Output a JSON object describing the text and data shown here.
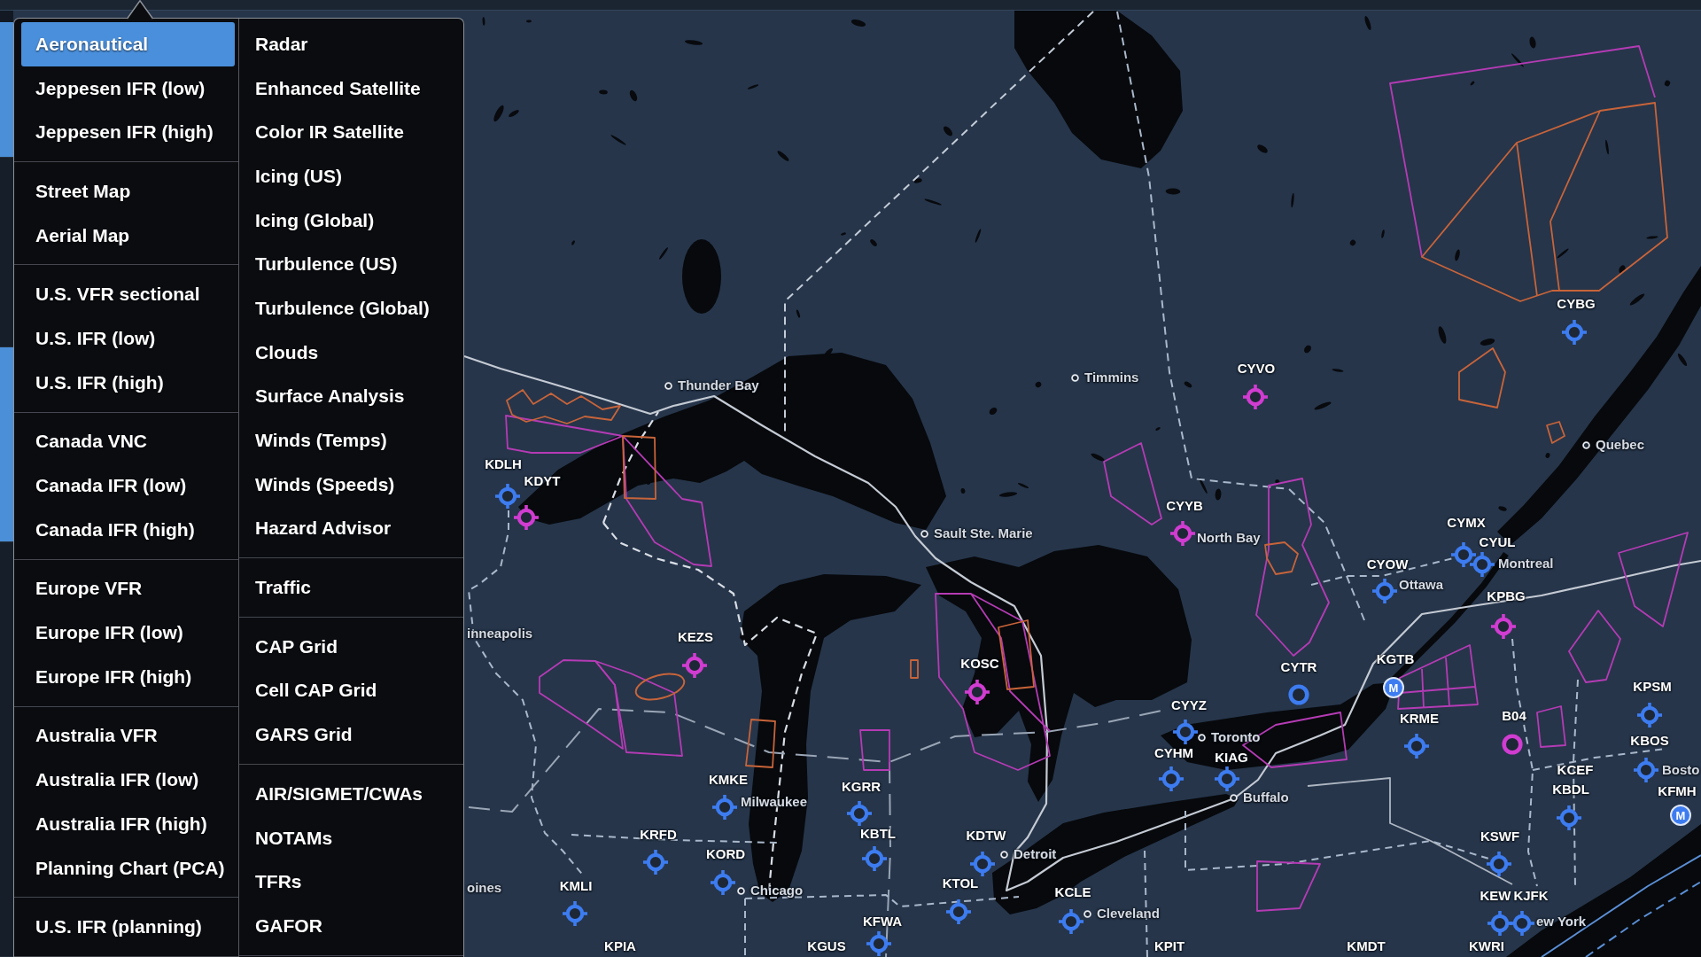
{
  "sidebar": {
    "buttons": [
      {
        "selected": true
      },
      {
        "selected": false
      },
      {
        "selected": true
      },
      {
        "selected": false
      }
    ]
  },
  "layer_menu": {
    "columns": [
      {
        "groups": [
          {
            "items": [
              {
                "label": "Aeronautical",
                "selected": true
              },
              {
                "label": "Jeppesen IFR (low)",
                "selected": false
              },
              {
                "label": "Jeppesen IFR (high)",
                "selected": false
              }
            ]
          },
          {
            "items": [
              {
                "label": "Street Map",
                "selected": false
              },
              {
                "label": "Aerial Map",
                "selected": false
              }
            ]
          },
          {
            "items": [
              {
                "label": "U.S. VFR sectional",
                "selected": false
              },
              {
                "label": "U.S. IFR (low)",
                "selected": false
              },
              {
                "label": "U.S. IFR (high)",
                "selected": false
              }
            ]
          },
          {
            "items": [
              {
                "label": "Canada VNC",
                "selected": false
              },
              {
                "label": "Canada IFR (low)",
                "selected": false
              },
              {
                "label": "Canada IFR (high)",
                "selected": false
              }
            ]
          },
          {
            "items": [
              {
                "label": "Europe VFR",
                "selected": false
              },
              {
                "label": "Europe IFR (low)",
                "selected": false
              },
              {
                "label": "Europe IFR (high)",
                "selected": false
              }
            ]
          },
          {
            "items": [
              {
                "label": "Australia VFR",
                "selected": false
              },
              {
                "label": "Australia IFR (low)",
                "selected": false
              },
              {
                "label": "Australia IFR (high)",
                "selected": false
              },
              {
                "label": "Planning Chart (PCA)",
                "selected": false
              }
            ]
          },
          {
            "items": [
              {
                "label": "U.S. IFR (planning)",
                "selected": false
              }
            ]
          }
        ]
      },
      {
        "groups": [
          {
            "items": [
              {
                "label": "Radar",
                "selected": false
              },
              {
                "label": "Enhanced Satellite",
                "selected": false
              },
              {
                "label": "Color IR Satellite",
                "selected": false
              },
              {
                "label": "Icing (US)",
                "selected": false
              },
              {
                "label": "Icing (Global)",
                "selected": false
              },
              {
                "label": "Turbulence (US)",
                "selected": false
              },
              {
                "label": "Turbulence (Global)",
                "selected": false
              },
              {
                "label": "Clouds",
                "selected": false
              },
              {
                "label": "Surface Analysis",
                "selected": false
              },
              {
                "label": "Winds (Temps)",
                "selected": false
              },
              {
                "label": "Winds (Speeds)",
                "selected": false
              },
              {
                "label": "Hazard Advisor",
                "selected": false
              }
            ]
          },
          {
            "items": [
              {
                "label": "Traffic",
                "selected": false
              }
            ]
          },
          {
            "items": [
              {
                "label": "CAP Grid",
                "selected": false
              },
              {
                "label": "Cell CAP Grid",
                "selected": false
              },
              {
                "label": "GARS Grid",
                "selected": false
              }
            ]
          },
          {
            "items": [
              {
                "label": "AIR/SIGMET/CWAs",
                "selected": false
              },
              {
                "label": "NOTAMs",
                "selected": false
              },
              {
                "label": "TFRs",
                "selected": false
              },
              {
                "label": "GAFOR",
                "selected": false
              }
            ]
          }
        ]
      }
    ]
  },
  "map": {
    "cities": [
      {
        "name": "Thunder Bay",
        "dot": true
      },
      {
        "name": "Timmins",
        "dot": true
      },
      {
        "name": "Quebec",
        "dot": true
      },
      {
        "name": "Sault Ste. Marie",
        "dot": true
      },
      {
        "name": "North Bay",
        "dot": false
      },
      {
        "name": "Montreal",
        "dot": false
      },
      {
        "name": "Ottawa",
        "dot": false
      },
      {
        "name": "inneapolis",
        "dot": false
      },
      {
        "name": "Toronto",
        "dot": true
      },
      {
        "name": "Bosto",
        "dot": false
      },
      {
        "name": "Milwaukee",
        "dot": false
      },
      {
        "name": "Buffalo",
        "dot": true
      },
      {
        "name": "Detroit",
        "dot": true
      },
      {
        "name": "oines",
        "dot": false
      },
      {
        "name": "Chicago",
        "dot": true
      },
      {
        "name": "Cleveland",
        "dot": true
      },
      {
        "name": "ew York",
        "dot": false
      }
    ],
    "airports": [
      {
        "code": "CYBG",
        "kind": "crosshair",
        "color": "#3d7cf0"
      },
      {
        "code": "CYVO",
        "kind": "crosshair",
        "color": "#d13cd1"
      },
      {
        "code": "KDLH",
        "kind": "crosshair",
        "color": "#3d7cf0"
      },
      {
        "code": "KDYT",
        "kind": "crosshair",
        "color": "#d13cd1"
      },
      {
        "code": "CYYB",
        "kind": "crosshair",
        "color": "#d13cd1"
      },
      {
        "code": "CYMX",
        "kind": "crosshair",
        "color": "#3d7cf0"
      },
      {
        "code": "CYUL",
        "kind": "crosshair",
        "color": "#3d7cf0"
      },
      {
        "code": "CYOW",
        "kind": "crosshair",
        "color": "#3d7cf0"
      },
      {
        "code": "KPBG",
        "kind": "crosshair",
        "color": "#d13cd1"
      },
      {
        "code": "KEZS",
        "kind": "crosshair",
        "color": "#d13cd1"
      },
      {
        "code": "KOSC",
        "kind": "crosshair",
        "color": "#d13cd1"
      },
      {
        "code": "CYTR",
        "kind": "ring",
        "color": "#3d7cf0"
      },
      {
        "code": "KGTB",
        "kind": "disc",
        "color": "#3d7cf0",
        "badge": "M"
      },
      {
        "code": "KPSM",
        "kind": "crosshair",
        "color": "#3d7cf0"
      },
      {
        "code": "CYYZ",
        "kind": "crosshair",
        "color": "#3d7cf0"
      },
      {
        "code": "KRME",
        "kind": "crosshair",
        "color": "#3d7cf0"
      },
      {
        "code": "B04",
        "kind": "ring",
        "color": "#d13cd1"
      },
      {
        "code": "KBOS",
        "kind": "crosshair",
        "color": "#3d7cf0"
      },
      {
        "code": "CYHM",
        "kind": "crosshair",
        "color": "#3d7cf0"
      },
      {
        "code": "KIAG",
        "kind": "crosshair",
        "color": "#3d7cf0"
      },
      {
        "code": "KCEF",
        "kind": "label"
      },
      {
        "code": "KMKE",
        "kind": "crosshair",
        "color": "#3d7cf0"
      },
      {
        "code": "KGRR",
        "kind": "crosshair",
        "color": "#3d7cf0"
      },
      {
        "code": "KBDL",
        "kind": "crosshair",
        "color": "#3d7cf0"
      },
      {
        "code": "KFMH",
        "kind": "disc",
        "color": "#3d7cf0",
        "badge": "M"
      },
      {
        "code": "KRFD",
        "kind": "crosshair",
        "color": "#3d7cf0"
      },
      {
        "code": "KBTL",
        "kind": "crosshair",
        "color": "#3d7cf0"
      },
      {
        "code": "KDTW",
        "kind": "crosshair",
        "color": "#3d7cf0"
      },
      {
        "code": "KSWF",
        "kind": "crosshair",
        "color": "#3d7cf0"
      },
      {
        "code": "KORD",
        "kind": "crosshair",
        "color": "#3d7cf0"
      },
      {
        "code": "KMLI",
        "kind": "crosshair",
        "color": "#3d7cf0"
      },
      {
        "code": "KTOL",
        "kind": "crosshair",
        "color": "#3d7cf0"
      },
      {
        "code": "KCLE",
        "kind": "crosshair",
        "color": "#3d7cf0"
      },
      {
        "code": "KEW",
        "kind": "crosshair",
        "color": "#3d7cf0"
      },
      {
        "code": "KJFK",
        "kind": "crosshair",
        "color": "#3d7cf0"
      },
      {
        "code": "KFWA",
        "kind": "crosshair",
        "color": "#3d7cf0"
      },
      {
        "code": "KPIA",
        "kind": "label"
      },
      {
        "code": "KGUS",
        "kind": "label"
      },
      {
        "code": "KPIT",
        "kind": "label"
      },
      {
        "code": "KMDT",
        "kind": "label"
      },
      {
        "code": "KWRI",
        "kind": "label"
      }
    ]
  }
}
